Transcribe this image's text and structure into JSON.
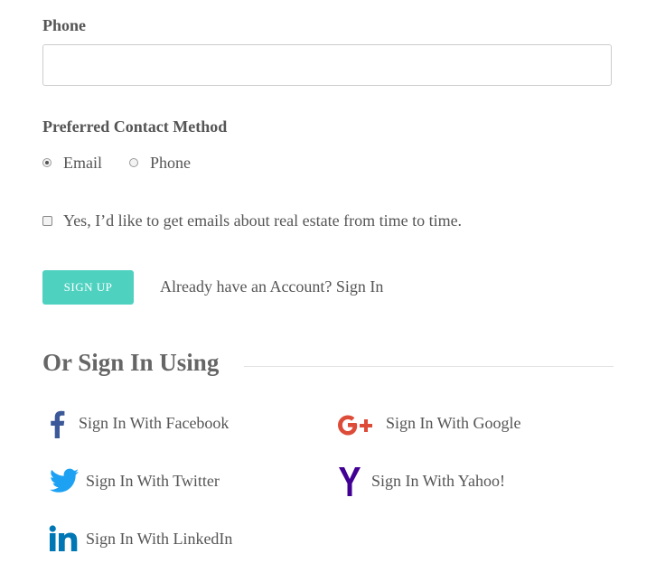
{
  "phone": {
    "label": "Phone",
    "value": "",
    "placeholder": ""
  },
  "contact_method": {
    "label": "Preferred Contact Method",
    "options": [
      {
        "label": "Email",
        "checked": true
      },
      {
        "label": "Phone",
        "checked": false
      }
    ]
  },
  "newsletter": {
    "label": "Yes, I’d like to get emails about real estate from time to time.",
    "checked": false
  },
  "actions": {
    "signup_label": "SIGN UP",
    "signin_prompt": "Already have an Account? Sign In"
  },
  "social": {
    "title": "Or Sign In Using",
    "providers": [
      {
        "label": "Sign In With Facebook",
        "icon": "facebook-icon",
        "color": "#3b5998"
      },
      {
        "label": "Sign In With Google",
        "icon": "google-plus-icon",
        "color": "#dd4b39"
      },
      {
        "label": "Sign In With Twitter",
        "icon": "twitter-icon",
        "color": "#1da1f2"
      },
      {
        "label": "Sign In With Yahoo!",
        "icon": "yahoo-icon",
        "color": "#410093"
      },
      {
        "label": "Sign In With LinkedIn",
        "icon": "linkedin-icon",
        "color": "#0077b5"
      }
    ]
  },
  "colors": {
    "accent": "#4fd1c0",
    "text": "#555555"
  }
}
